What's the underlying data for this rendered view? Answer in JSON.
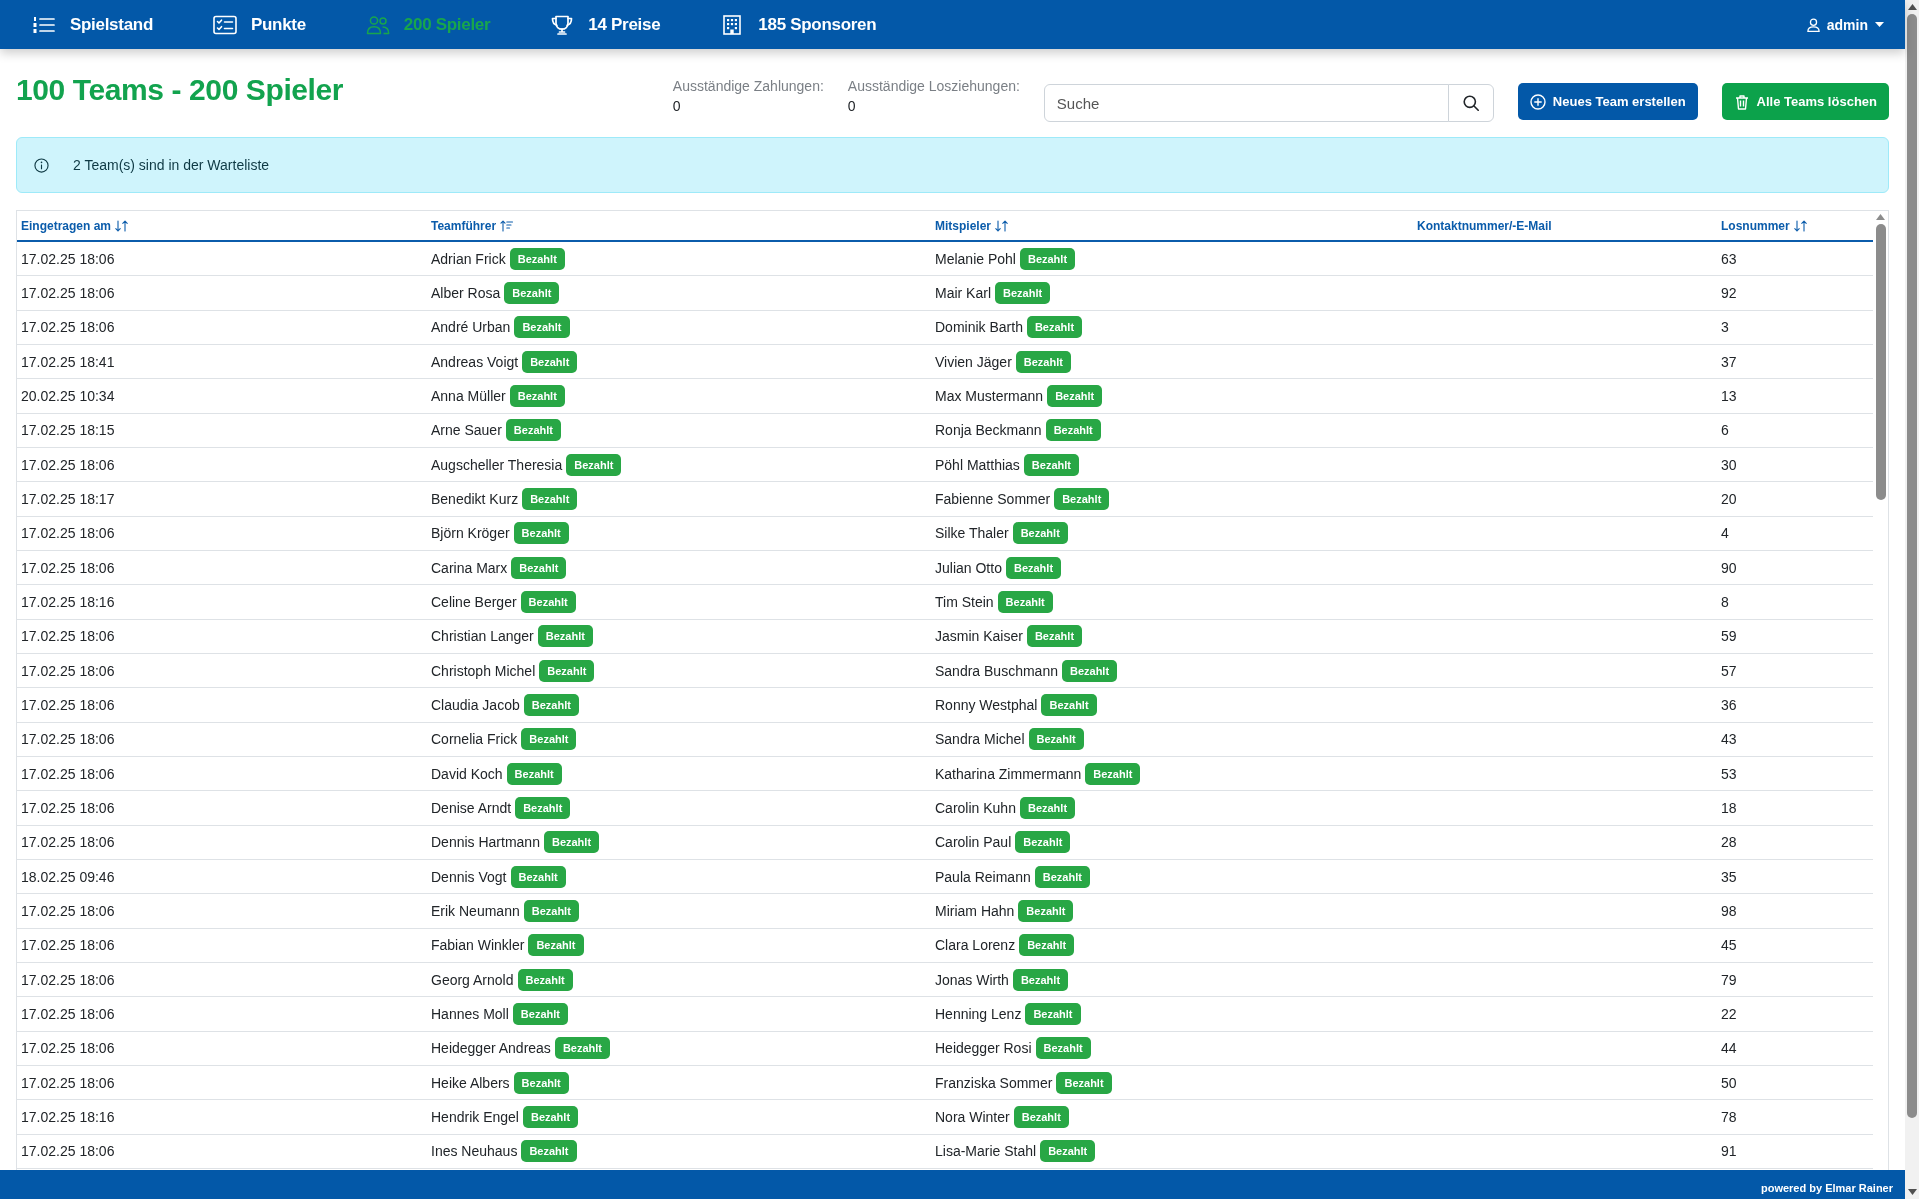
{
  "nav": {
    "items": [
      {
        "label": "Spielstand",
        "selected": false
      },
      {
        "label": "Punkte",
        "selected": false
      },
      {
        "label": "200 Spieler",
        "selected": true
      },
      {
        "label": "14 Preise",
        "selected": false
      },
      {
        "label": "185 Sponsoren",
        "selected": false
      }
    ],
    "user": {
      "label": "admin"
    }
  },
  "header": {
    "title": "100 Teams - 200 Spieler",
    "stats": [
      {
        "label": "Ausständige Zahlungen:",
        "value": "0"
      },
      {
        "label": "Ausständige Losziehungen:",
        "value": "0"
      }
    ],
    "search": {
      "placeholder": "Suche"
    },
    "buttons": [
      {
        "label": "Neues Team erstellen",
        "kind": "create"
      },
      {
        "label": "Alle Teams löschen",
        "kind": "delete"
      }
    ]
  },
  "alert": {
    "text": "2 Team(s) sind in der Warteliste"
  },
  "table": {
    "columns": [
      {
        "label": "Eingetragen am",
        "kind": "sortable"
      },
      {
        "label": "Teamführer",
        "kind": "sorted"
      },
      {
        "label": "Mitspieler",
        "kind": "sortable"
      },
      {
        "label": "Kontaktnummer/-E-Mail",
        "kind": "plain"
      },
      {
        "label": "Losnummer",
        "kind": "sortable"
      }
    ],
    "rows": [
      {
        "registered": "17.02.25 18:06",
        "leader": {
          "name": "Adrian Frick",
          "badge": "Bezahlt"
        },
        "partner": {
          "name": "Melanie Pohl",
          "badge": "Bezahlt"
        },
        "lot": "63"
      },
      {
        "registered": "17.02.25 18:06",
        "leader": {
          "name": "Alber Rosa",
          "badge": "Bezahlt"
        },
        "partner": {
          "name": "Mair Karl",
          "badge": "Bezahlt"
        },
        "lot": "92"
      },
      {
        "registered": "17.02.25 18:06",
        "leader": {
          "name": "André Urban",
          "badge": "Bezahlt"
        },
        "partner": {
          "name": "Dominik Barth",
          "badge": "Bezahlt"
        },
        "lot": "3"
      },
      {
        "registered": "17.02.25 18:41",
        "leader": {
          "name": "Andreas Voigt",
          "badge": "Bezahlt"
        },
        "partner": {
          "name": "Vivien Jäger",
          "badge": "Bezahlt"
        },
        "lot": "37"
      },
      {
        "registered": "20.02.25 10:34",
        "leader": {
          "name": "Anna Müller",
          "badge": "Bezahlt"
        },
        "partner": {
          "name": "Max Mustermann",
          "badge": "Bezahlt"
        },
        "lot": "13"
      },
      {
        "registered": "17.02.25 18:15",
        "leader": {
          "name": "Arne Sauer",
          "badge": "Bezahlt"
        },
        "partner": {
          "name": "Ronja Beckmann",
          "badge": "Bezahlt"
        },
        "lot": "6"
      },
      {
        "registered": "17.02.25 18:06",
        "leader": {
          "name": "Augscheller Theresia",
          "badge": "Bezahlt"
        },
        "partner": {
          "name": "Pöhl Matthias",
          "badge": "Bezahlt"
        },
        "lot": "30"
      },
      {
        "registered": "17.02.25 18:17",
        "leader": {
          "name": "Benedikt Kurz",
          "badge": "Bezahlt"
        },
        "partner": {
          "name": "Fabienne Sommer",
          "badge": "Bezahlt"
        },
        "lot": "20"
      },
      {
        "registered": "17.02.25 18:06",
        "leader": {
          "name": "Björn Kröger",
          "badge": "Bezahlt"
        },
        "partner": {
          "name": "Silke Thaler",
          "badge": "Bezahlt"
        },
        "lot": "4"
      },
      {
        "registered": "17.02.25 18:06",
        "leader": {
          "name": "Carina Marx",
          "badge": "Bezahlt"
        },
        "partner": {
          "name": "Julian Otto",
          "badge": "Bezahlt"
        },
        "lot": "90"
      },
      {
        "registered": "17.02.25 18:16",
        "leader": {
          "name": "Celine Berger",
          "badge": "Bezahlt"
        },
        "partner": {
          "name": "Tim Stein",
          "badge": "Bezahlt"
        },
        "lot": "8"
      },
      {
        "registered": "17.02.25 18:06",
        "leader": {
          "name": "Christian Langer",
          "badge": "Bezahlt"
        },
        "partner": {
          "name": "Jasmin Kaiser",
          "badge": "Bezahlt"
        },
        "lot": "59"
      },
      {
        "registered": "17.02.25 18:06",
        "leader": {
          "name": "Christoph Michel",
          "badge": "Bezahlt"
        },
        "partner": {
          "name": "Sandra Buschmann",
          "badge": "Bezahlt"
        },
        "lot": "57"
      },
      {
        "registered": "17.02.25 18:06",
        "leader": {
          "name": "Claudia Jacob",
          "badge": "Bezahlt"
        },
        "partner": {
          "name": "Ronny Westphal",
          "badge": "Bezahlt"
        },
        "lot": "36"
      },
      {
        "registered": "17.02.25 18:06",
        "leader": {
          "name": "Cornelia Frick",
          "badge": "Bezahlt"
        },
        "partner": {
          "name": "Sandra Michel",
          "badge": "Bezahlt"
        },
        "lot": "43"
      },
      {
        "registered": "17.02.25 18:06",
        "leader": {
          "name": "David Koch",
          "badge": "Bezahlt"
        },
        "partner": {
          "name": "Katharina Zimmermann",
          "badge": "Bezahlt"
        },
        "lot": "53"
      },
      {
        "registered": "17.02.25 18:06",
        "leader": {
          "name": "Denise Arndt",
          "badge": "Bezahlt"
        },
        "partner": {
          "name": "Carolin Kuhn",
          "badge": "Bezahlt"
        },
        "lot": "18"
      },
      {
        "registered": "17.02.25 18:06",
        "leader": {
          "name": "Dennis Hartmann",
          "badge": "Bezahlt"
        },
        "partner": {
          "name": "Carolin Paul",
          "badge": "Bezahlt"
        },
        "lot": "28"
      },
      {
        "registered": "18.02.25 09:46",
        "leader": {
          "name": "Dennis Vogt",
          "badge": "Bezahlt"
        },
        "partner": {
          "name": "Paula Reimann",
          "badge": "Bezahlt"
        },
        "lot": "35"
      },
      {
        "registered": "17.02.25 18:06",
        "leader": {
          "name": "Erik Neumann",
          "badge": "Bezahlt"
        },
        "partner": {
          "name": "Miriam Hahn",
          "badge": "Bezahlt"
        },
        "lot": "98"
      },
      {
        "registered": "17.02.25 18:06",
        "leader": {
          "name": "Fabian Winkler",
          "badge": "Bezahlt"
        },
        "partner": {
          "name": "Clara Lorenz",
          "badge": "Bezahlt"
        },
        "lot": "45"
      },
      {
        "registered": "17.02.25 18:06",
        "leader": {
          "name": "Georg Arnold",
          "badge": "Bezahlt"
        },
        "partner": {
          "name": "Jonas Wirth",
          "badge": "Bezahlt"
        },
        "lot": "79"
      },
      {
        "registered": "17.02.25 18:06",
        "leader": {
          "name": "Hannes Moll",
          "badge": "Bezahlt"
        },
        "partner": {
          "name": "Henning Lenz",
          "badge": "Bezahlt"
        },
        "lot": "22"
      },
      {
        "registered": "17.02.25 18:06",
        "leader": {
          "name": "Heidegger Andreas",
          "badge": "Bezahlt"
        },
        "partner": {
          "name": "Heidegger Rosi",
          "badge": "Bezahlt"
        },
        "lot": "44"
      },
      {
        "registered": "17.02.25 18:06",
        "leader": {
          "name": "Heike Albers",
          "badge": "Bezahlt"
        },
        "partner": {
          "name": "Franziska Sommer",
          "badge": "Bezahlt"
        },
        "lot": "50"
      },
      {
        "registered": "17.02.25 18:16",
        "leader": {
          "name": "Hendrik Engel",
          "badge": "Bezahlt"
        },
        "partner": {
          "name": "Nora Winter",
          "badge": "Bezahlt"
        },
        "lot": "78"
      },
      {
        "registered": "17.02.25 18:06",
        "leader": {
          "name": "Ines Neuhaus",
          "badge": "Bezahlt"
        },
        "partner": {
          "name": "Lisa-Marie Stahl",
          "badge": "Bezahlt"
        },
        "lot": "91"
      }
    ]
  },
  "footer": {
    "text": "powered by Elmar Rainer"
  }
}
